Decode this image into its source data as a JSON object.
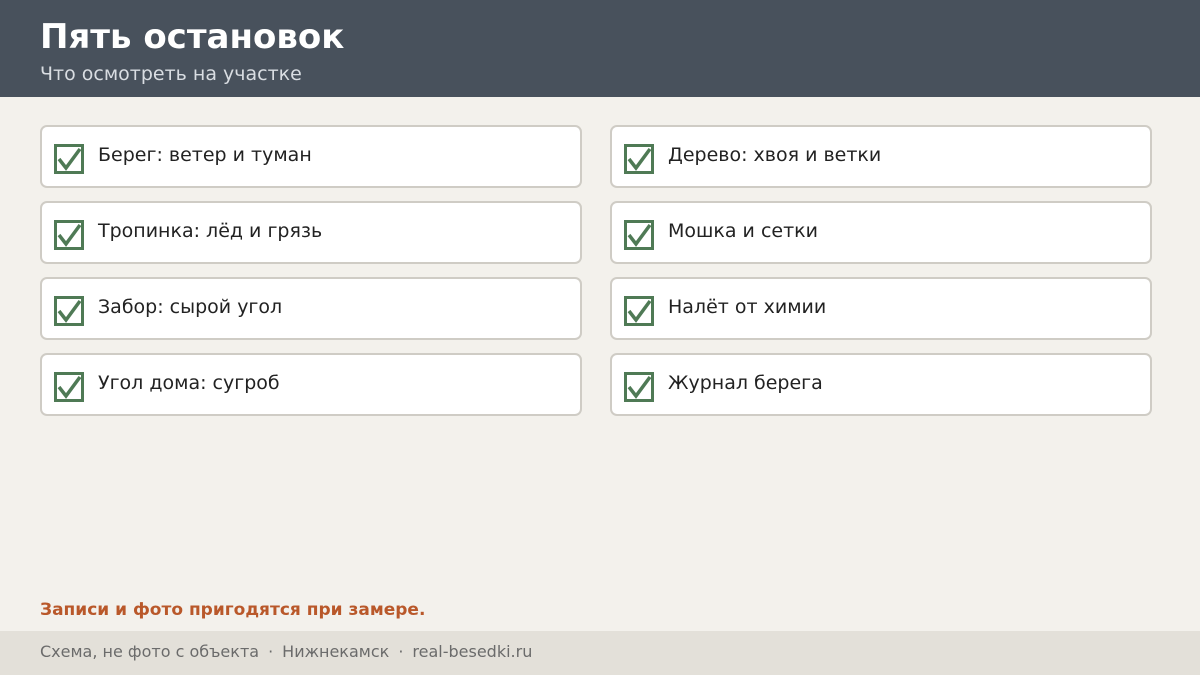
{
  "header": {
    "title": "Пять остановок",
    "subtitle": "Что осмотреть на участке"
  },
  "checklist": {
    "check_color": "#4f7a55",
    "items": [
      {
        "label": "Берег: ветер и туман",
        "checked": true
      },
      {
        "label": "Тропинка: лёд и грязь",
        "checked": true
      },
      {
        "label": "Забор: сырой угол",
        "checked": true
      },
      {
        "label": "Угол дома: сугроб",
        "checked": true
      },
      {
        "label": "Дерево: хвоя и ветки",
        "checked": true
      },
      {
        "label": "Мошка и сетки",
        "checked": true
      },
      {
        "label": "Налёт от химии",
        "checked": true
      },
      {
        "label": "Журнал берега",
        "checked": true
      }
    ]
  },
  "note": "Записи и фото пригодятся при замере.",
  "footer": {
    "caption": "Схема, не фото с объекта",
    "separator": "·",
    "city": "Нижнекамск",
    "site": "real-besedki.ru"
  }
}
